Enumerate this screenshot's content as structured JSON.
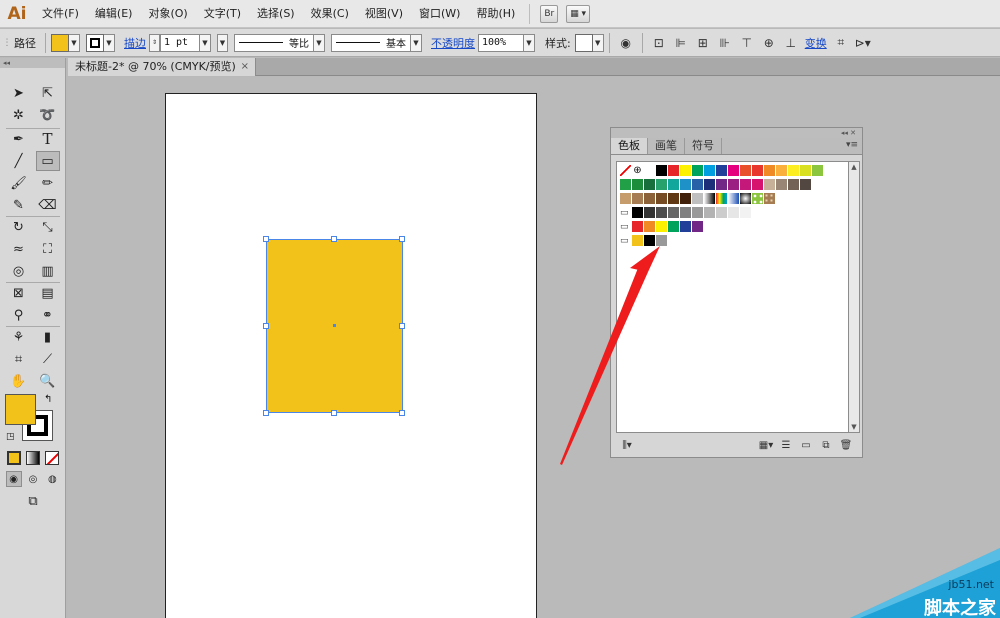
{
  "app": {
    "logo": "Ai",
    "menu": [
      "文件(F)",
      "编辑(E)",
      "对象(O)",
      "文字(T)",
      "选择(S)",
      "效果(C)",
      "视图(V)",
      "窗口(W)",
      "帮助(H)"
    ],
    "bridge_button": "Br"
  },
  "controlbar": {
    "path_label": "路径",
    "stroke_link": "描边",
    "stroke_weight": "1 pt",
    "profile_label": "等比",
    "brush_label": "基本",
    "opacity_link": "不透明度",
    "opacity_value": "100%",
    "style_label": "样式:",
    "transform_link": "变换"
  },
  "document": {
    "tab_title": "未标题-2* @ 70% (CMYK/预览)",
    "close_glyph": "×"
  },
  "colors": {
    "fill": "#f2c11a",
    "selection": "#4a86e8",
    "arrow": "#ee1c1c"
  },
  "swatches_panel": {
    "tabs": [
      "色板",
      "画笔",
      "符号"
    ],
    "rows": [
      [
        "none",
        "reg",
        "#ffffff",
        "#000000",
        "#e6262b",
        "#fdf100",
        "#00a35c",
        "#009fdf",
        "#213f98",
        "#e4007f",
        "#e94f2b",
        "#e8382e",
        "#f08a24",
        "#fbb03b",
        "#fcee21",
        "#d9e021",
        "#8cc63f"
      ],
      [
        "#22a048",
        "#1b8d3b",
        "#17703c",
        "#27a26d",
        "#12a79d",
        "#1e92c8",
        "#2762a8",
        "#1e2f7a",
        "#702785",
        "#9b1f82",
        "#c4187b",
        "#d6136e",
        "#c7b299",
        "#998675",
        "#736357",
        "#534741"
      ],
      [
        "#c69c6d",
        "#a67c52",
        "#8c6239",
        "#754c24",
        "#603813",
        "#42210b",
        "#bfbfbf",
        "grad-bw",
        "grad-rainbow",
        "grad-blue",
        "grad-radial",
        "pattern-green",
        "pattern-brown"
      ],
      [
        "folder",
        "#000000",
        "#333333",
        "#4d4d4d",
        "#666666",
        "#808080",
        "#999999",
        "#b3b3b3",
        "#cccccc",
        "#e6e6e6",
        "#f2f2f2",
        "#ffffff"
      ],
      [
        "folder",
        "#e6262b",
        "#f08a24",
        "#fdf100",
        "#00a35c",
        "#213f98",
        "#702785"
      ],
      [
        "folder",
        "#f2c11a",
        "#000000",
        "#999999"
      ]
    ]
  },
  "watermark": {
    "site": "jb51.net",
    "name": "脚本之家"
  }
}
